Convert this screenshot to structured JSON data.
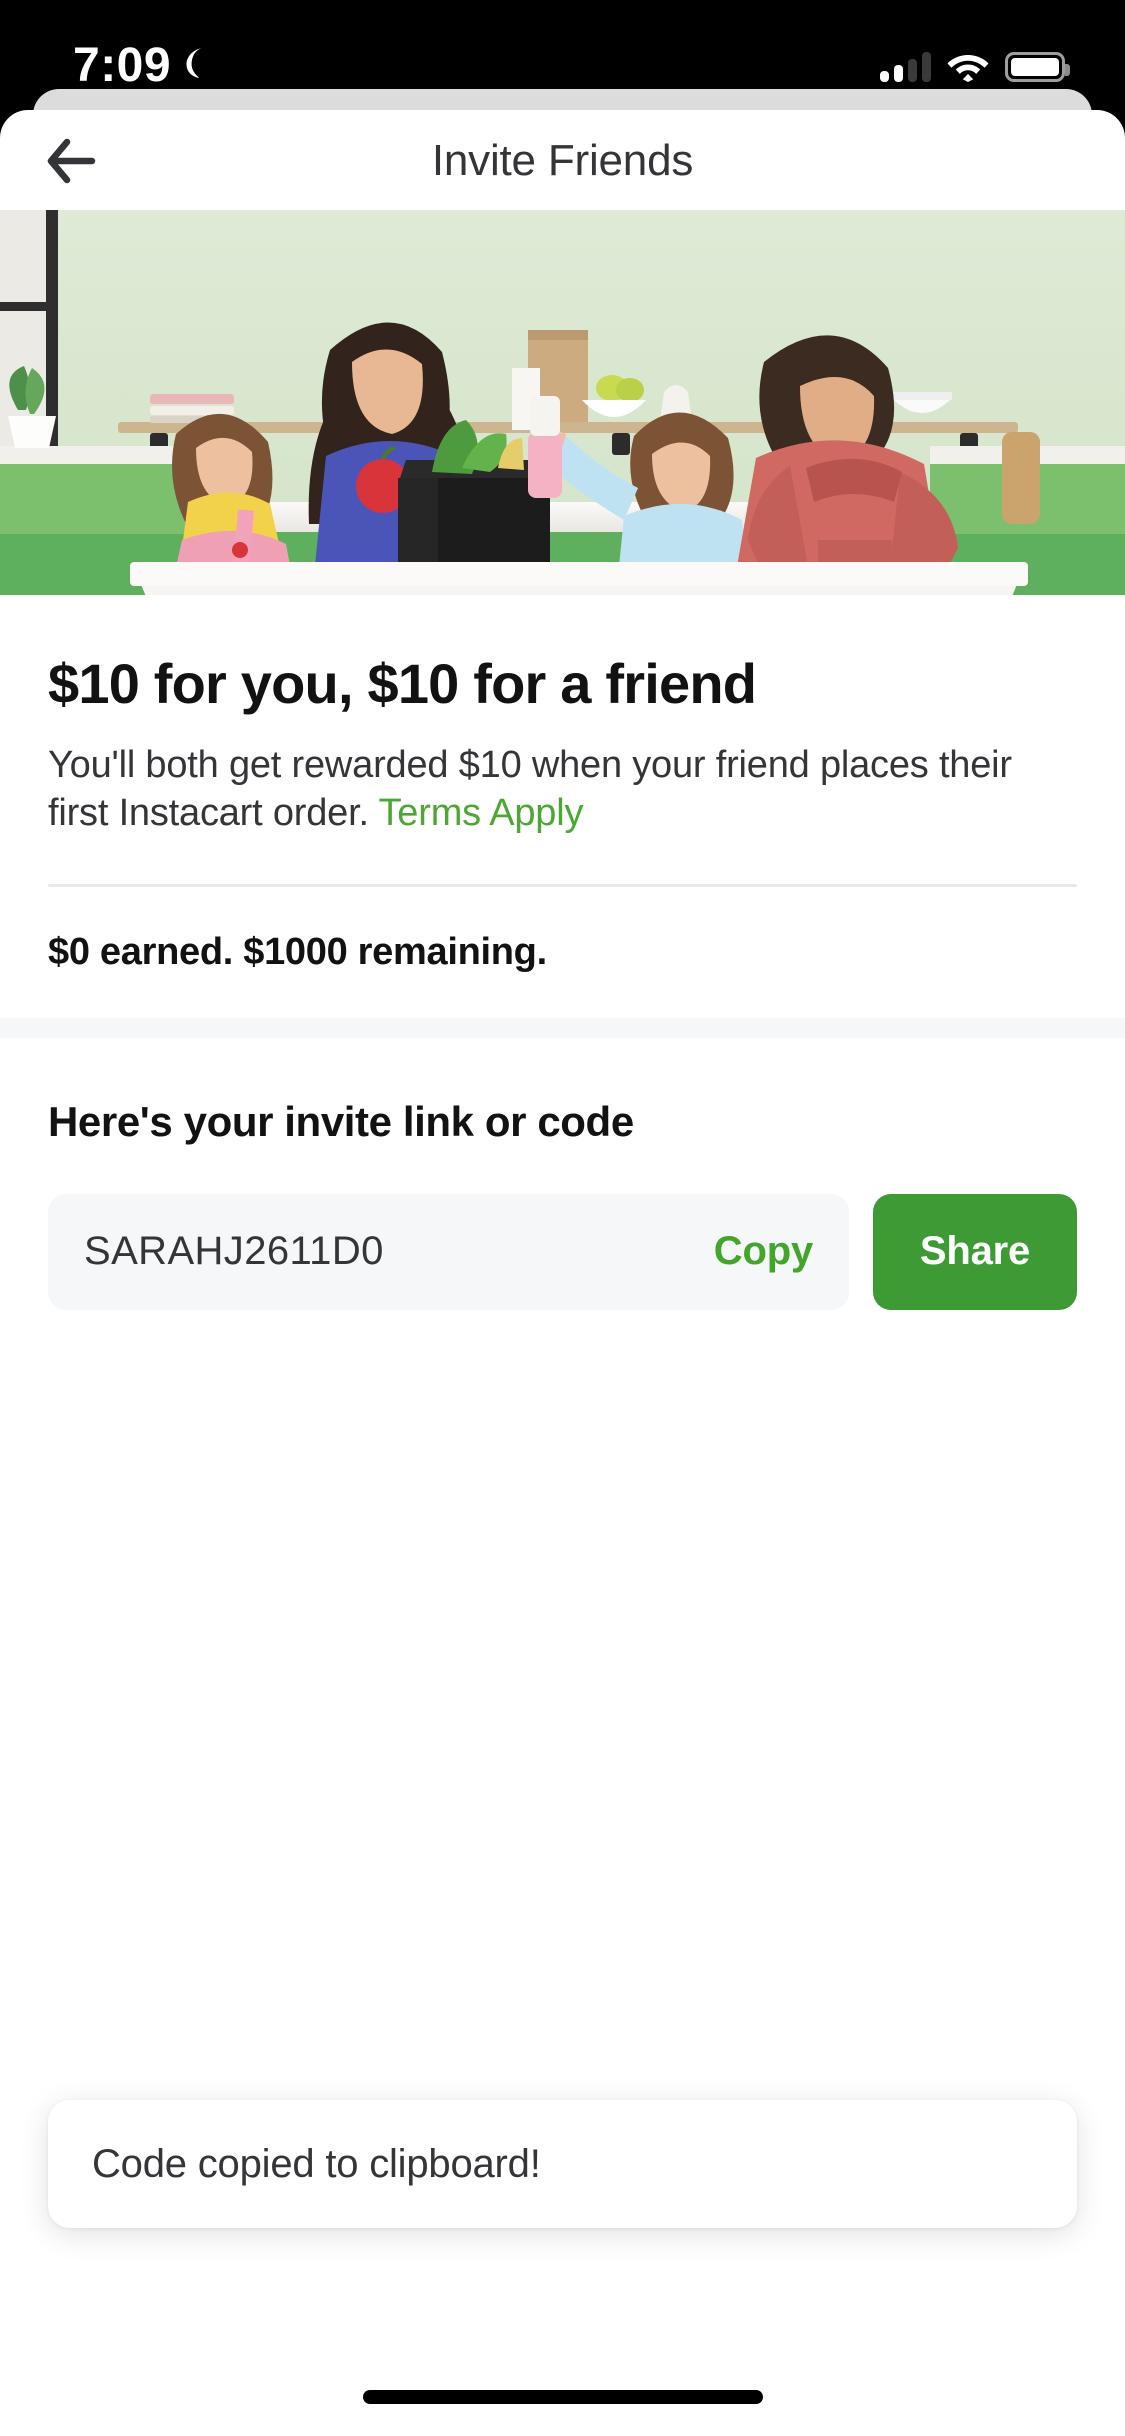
{
  "status_bar": {
    "time": "7:09",
    "moon_icon": "crescent-moon-icon",
    "signal_icon": "cellular-signal-icon",
    "signal_bars_active": 2,
    "signal_bars_total": 4,
    "wifi_icon": "wifi-icon",
    "battery_icon": "battery-icon",
    "battery_level_percent": 100
  },
  "nav": {
    "back_icon": "back-arrow-icon",
    "title": "Invite Friends"
  },
  "hero": {
    "alt": "family-in-kitchen-with-grocery-bag-photo",
    "wall_color": "#d9e7cf",
    "island_color": "#5fb05e",
    "counter_color": "#f2f1ee",
    "bag_color": "#1e1e1e"
  },
  "offer": {
    "headline": "$10 for you, $10 for a friend",
    "description_before_link": "You'll both get rewarded $10 when your friend places their first Instacart order. ",
    "terms_link": "Terms Apply",
    "terms_link_color": "#4CA832",
    "progress_text": "$0 earned. $1000 remaining.",
    "earned_amount": "$0",
    "remaining_amount": "$1000"
  },
  "invite": {
    "section_title": "Here's your invite link or code",
    "code": "SARAHJ2611D0",
    "copy_label": "Copy",
    "copy_color": "#41A62A",
    "share_label": "Share",
    "share_bg": "#3D9A35"
  },
  "toast": {
    "message": "Code copied to clipboard!"
  },
  "home_indicator": "home-indicator"
}
